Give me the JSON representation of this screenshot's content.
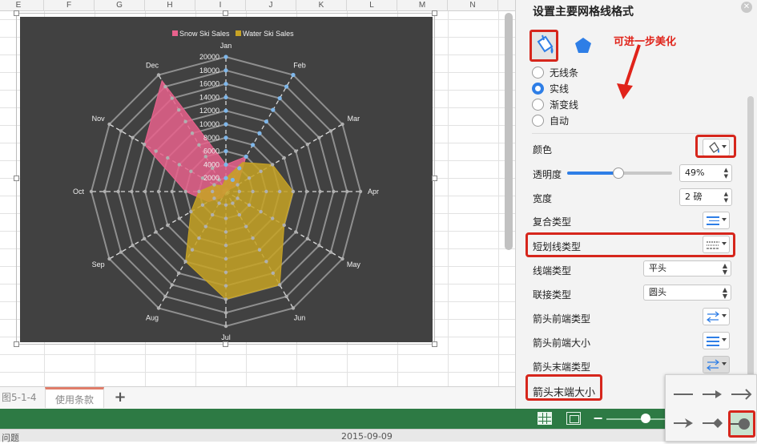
{
  "spreadsheet": {
    "columns": [
      "E",
      "F",
      "G",
      "H",
      "I",
      "J",
      "K",
      "L",
      "M",
      "N"
    ],
    "sheet_tabs": [
      "图5-1-4",
      "使用条款"
    ],
    "add_sheet_label": "+",
    "bottom_texts": [
      "问题",
      "2015-09-09"
    ]
  },
  "chart_data": {
    "type": "radar",
    "title": "",
    "categories": [
      "Jan",
      "Feb",
      "Mar",
      "Apr",
      "May",
      "Jun",
      "Jul",
      "Aug",
      "Sep",
      "Oct",
      "Nov",
      "Dec"
    ],
    "radial_ticks": [
      2000,
      4000,
      6000,
      8000,
      10000,
      12000,
      14000,
      16000,
      18000,
      20000
    ],
    "range": [
      0,
      20000
    ],
    "legend": "top",
    "series": [
      {
        "name": "Snow Ski Sales",
        "color": "#e8618c",
        "values": [
          4000,
          6000,
          2000,
          0,
          0,
          0,
          0,
          1000,
          3000,
          6000,
          14000,
          19000
        ]
      },
      {
        "name": "Water Ski Sales",
        "color": "#c7a325",
        "values": [
          2000,
          5000,
          8000,
          10000,
          10000,
          16000,
          16000,
          12000,
          6000,
          4000,
          2000,
          1000
        ]
      }
    ]
  },
  "panel": {
    "title": "设置主要网格线格式",
    "callout": "可进一步美化",
    "line_options": [
      {
        "label": "无线条",
        "selected": false
      },
      {
        "label": "实线",
        "selected": true
      },
      {
        "label": "渐变线",
        "selected": false
      },
      {
        "label": "自动",
        "selected": false
      }
    ],
    "color_label": "颜色",
    "transparency_label": "透明度",
    "transparency_value": "49%",
    "transparency_fraction": 0.49,
    "width_label": "宽度",
    "width_value": "2 磅",
    "compound_label": "复合类型",
    "dash_label": "短划线类型",
    "cap_label": "线端类型",
    "cap_value": "平头",
    "join_label": "联接类型",
    "join_value": "圆头",
    "arrow_begin_type_label": "箭头前端类型",
    "arrow_begin_size_label": "箭头前端大小",
    "arrow_end_type_label": "箭头末端类型",
    "arrow_end_size_label": "箭头末端大小"
  },
  "colors": {
    "accent": "#2e7ee6",
    "highlight": "#d6261c",
    "status_bar": "#2d7a44",
    "chart_bg": "#414141"
  }
}
